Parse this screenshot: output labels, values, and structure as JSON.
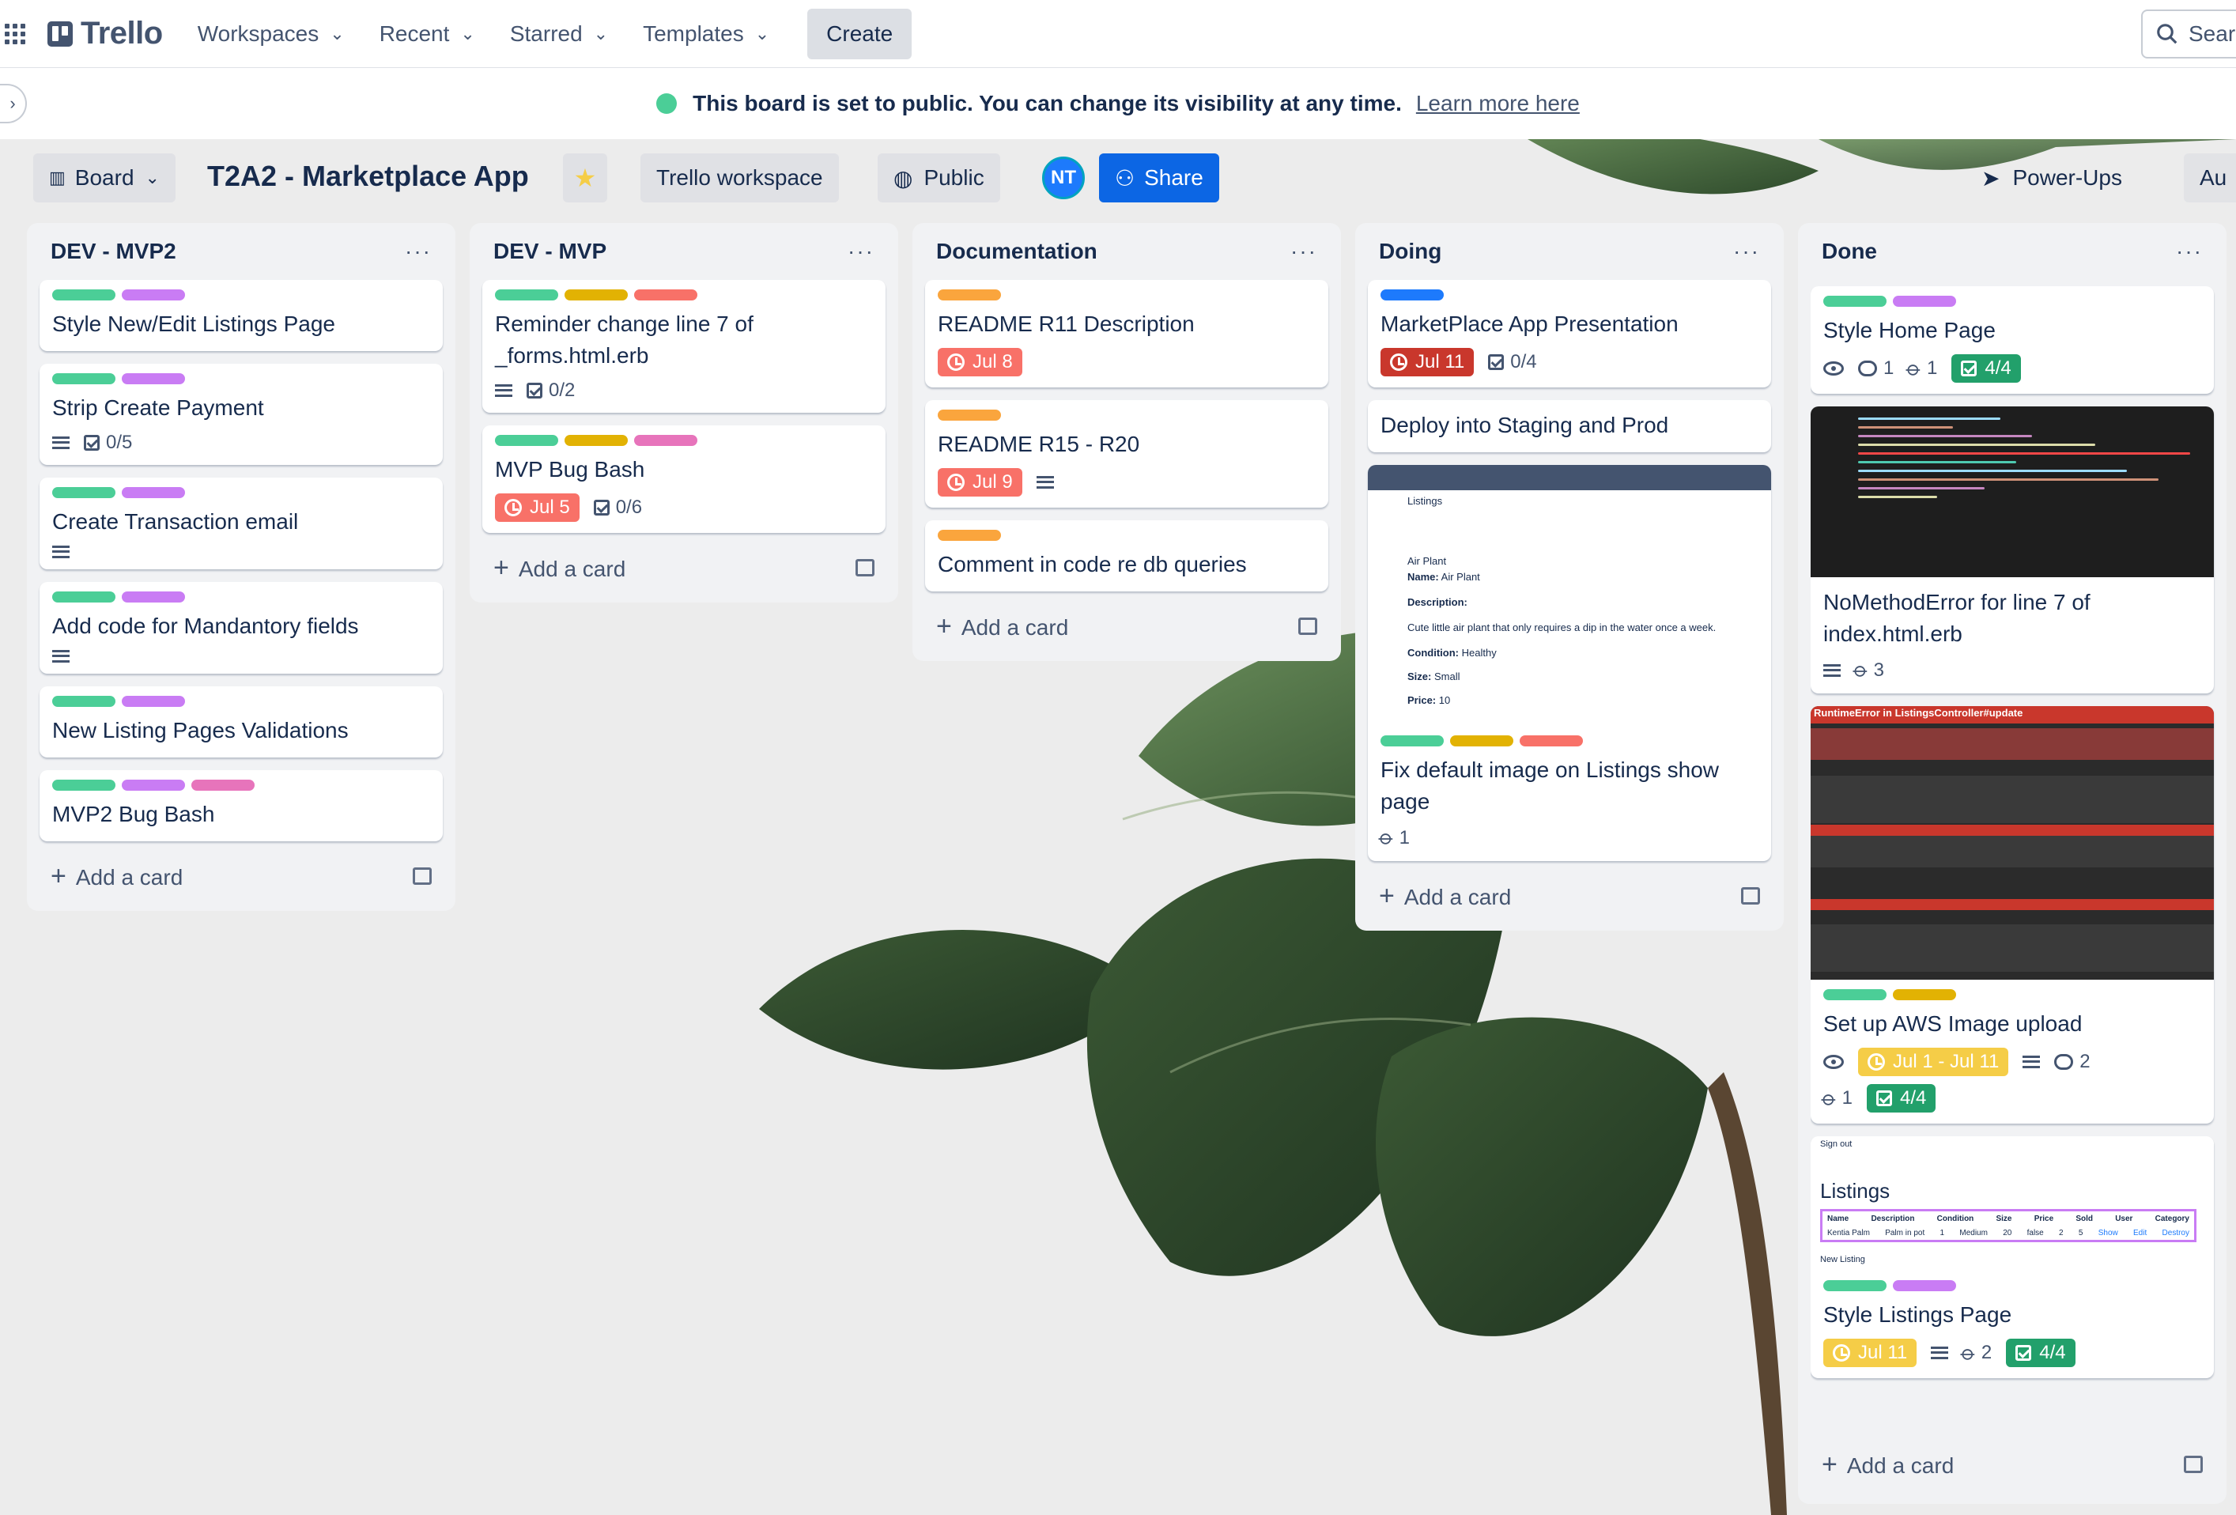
{
  "nav": {
    "logo": "Trello",
    "items": [
      "Workspaces",
      "Recent",
      "Starred",
      "Templates"
    ],
    "create": "Create",
    "search": "Sear"
  },
  "banner": {
    "message": "This board is set to public. You can change its visibility at any time.",
    "link": "Learn more here"
  },
  "board": {
    "view": "Board",
    "title": "T2A2 - Marketplace App",
    "workspace": "Trello workspace",
    "visibility": "Public",
    "avatar": "NT",
    "share": "Share",
    "powerups": "Power-Ups",
    "automation": "Au"
  },
  "add_card": "Add a card",
  "lists": [
    {
      "title": "DEV - MVP2",
      "cards": [
        {
          "title": "Style New/Edit Listings Page",
          "labels": [
            "#4bce97",
            "#c97cf4"
          ]
        },
        {
          "title": "Strip Create Payment",
          "labels": [
            "#4bce97",
            "#c97cf4"
          ],
          "checklist": "0/5"
        },
        {
          "title": "Create Transaction email",
          "labels": [
            "#4bce97",
            "#c97cf4"
          ]
        },
        {
          "title": "Add code for Mandantory fields",
          "labels": [
            "#4bce97",
            "#c97cf4"
          ]
        },
        {
          "title": "New Listing Pages Validations",
          "labels": [
            "#4bce97",
            "#c97cf4"
          ]
        },
        {
          "title": "MVP2 Bug Bash",
          "labels": [
            "#4bce97",
            "#c97cf4",
            "#e774bb"
          ]
        }
      ]
    },
    {
      "title": "DEV - MVP",
      "cards": [
        {
          "title": "Reminder change line 7 of _forms.html.erb",
          "labels": [
            "#4bce97",
            "#e2b203",
            "#f87168"
          ],
          "checklist": "0/2"
        },
        {
          "title": "MVP Bug Bash",
          "labels": [
            "#4bce97",
            "#e2b203",
            "#e774bb"
          ],
          "due": "Jul 5",
          "checklist": "0/6"
        }
      ]
    },
    {
      "title": "Documentation",
      "cards": [
        {
          "title": "README R11 Description",
          "labels": [
            "#faa53d"
          ],
          "due": "Jul 8"
        },
        {
          "title": "README R15 - R20",
          "labels": [
            "#faa53d"
          ],
          "due": "Jul 9"
        },
        {
          "title": "Comment in code re db queries",
          "labels": [
            "#faa53d"
          ]
        }
      ]
    },
    {
      "title": "Doing",
      "cards": [
        {
          "title": "MarketPlace App Presentation",
          "labels": [
            "#1d7afc"
          ],
          "due": "Jul 11",
          "checklist": "0/4"
        },
        {
          "title": "Deploy into Staging and Prod"
        },
        {
          "title": "Fix default image on Listings show page",
          "labels": [
            "#4bce97",
            "#e2b203",
            "#f87168"
          ],
          "attachments": "1",
          "cover": {
            "heading": "Listings",
            "img_alt": "Air Plant",
            "name_label": "Name:",
            "name": "Air Plant",
            "desc_label": "Description:",
            "desc": "Cute little air plant that only requires a dip in the water once a week.",
            "condition_label": "Condition:",
            "condition": "Healthy",
            "size_label": "Size:",
            "size": "Small",
            "price_label": "Price:",
            "price": "10"
          }
        }
      ]
    },
    {
      "title": "Done",
      "cards": [
        {
          "title": "Style Home Page",
          "labels": [
            "#4bce97",
            "#c97cf4"
          ],
          "comments": "1",
          "attachments": "1",
          "checklist": "4/4"
        },
        {
          "title": "NoMethodError for line 7 of index.html.erb",
          "attachments": "3"
        },
        {
          "title": "Set up AWS Image upload",
          "labels": [
            "#4bce97",
            "#e2b203"
          ],
          "due": "Jul 1 - Jul 11",
          "comments": "2",
          "attachments": "1",
          "checklist": "4/4",
          "cover": {
            "error_title": "RuntimeError in ListingsController#update"
          }
        },
        {
          "title": "Style Listings Page",
          "labels": [
            "#4bce97",
            "#c97cf4"
          ],
          "due": "Jul 11",
          "attachments": "2",
          "checklist": "4/4",
          "cover": {
            "signout": "Sign out",
            "heading": "Listings",
            "columns": [
              "Name",
              "Description",
              "Condition",
              "Size",
              "Price",
              "Sold",
              "User",
              "Category"
            ],
            "row": [
              "Kentia Palm",
              "Palm in pot",
              "1",
              "Medium",
              "20",
              "false",
              "2",
              "5"
            ],
            "actions": [
              "Show",
              "Edit",
              "Destroy"
            ],
            "new_listing": "New Listing"
          }
        }
      ]
    }
  ]
}
